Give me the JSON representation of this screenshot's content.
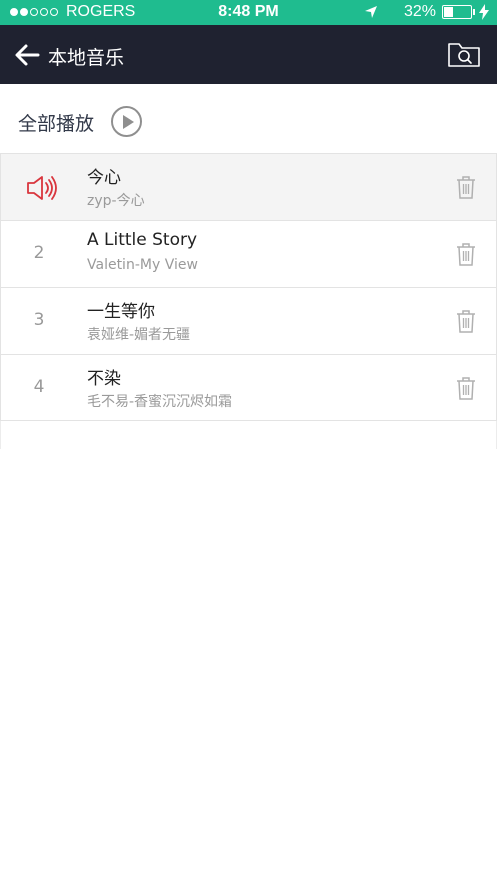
{
  "status_bar": {
    "carrier": "ROGERS",
    "signal_dots_filled": 2,
    "signal_dots_total": 5,
    "time": "8:48 PM",
    "battery_percent_label": "32%",
    "battery_level": 0.32,
    "location_icon": "location-arrow-icon",
    "charging_icon": "bolt-icon"
  },
  "navbar": {
    "title": "本地音乐",
    "back_icon": "back-arrow-icon",
    "folder_icon": "folder-search-icon"
  },
  "play_all": {
    "label": "全部播放",
    "icon": "play-icon"
  },
  "colors": {
    "status_bar": "#1fbc8f",
    "navbar": "#1f2230",
    "now_playing": "#d9363e",
    "row_active_bg": "#f4f4f4"
  },
  "songs": [
    {
      "index": "",
      "now_playing": true,
      "title": "今心",
      "subtitle": "zyp-今心"
    },
    {
      "index": "2",
      "now_playing": false,
      "title": "A Little Story",
      "subtitle": "Valetin-My View"
    },
    {
      "index": "3",
      "now_playing": false,
      "title": "一生等你",
      "subtitle": "袁娅维-媚者无疆"
    },
    {
      "index": "4",
      "now_playing": false,
      "title": "不染",
      "subtitle": "毛不易-香蜜沉沉烬如霜"
    }
  ]
}
